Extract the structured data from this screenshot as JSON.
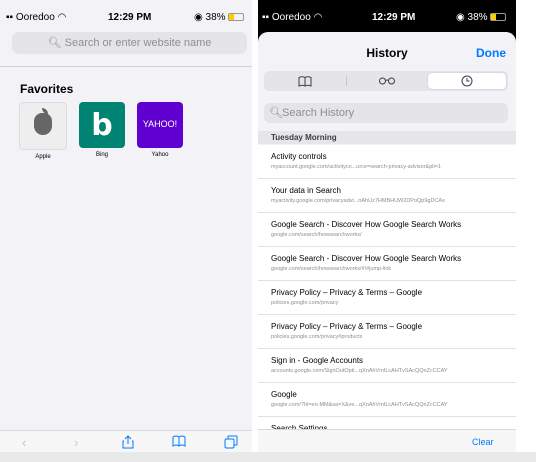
{
  "left": {
    "status": {
      "carrier": "Ooredoo",
      "time": "12:29 PM",
      "battery": "38%"
    },
    "search_placeholder": "Search or enter website name",
    "favorites_title": "Favorites",
    "favorites": [
      {
        "label": "Apple",
        "tile_color": "#eeeeee",
        "glyph": "",
        "glyph_color": "#555555"
      },
      {
        "label": "Bing",
        "tile_color": "#008373",
        "glyph": "b",
        "glyph_color": "#ffffff"
      },
      {
        "label": "Yahoo",
        "tile_color": "#6001d2",
        "glyph": "YAHOO!",
        "glyph_color": "#ffffff"
      }
    ],
    "toolbar_icons": [
      "back-icon",
      "forward-icon",
      "share-icon",
      "bookmarks-icon",
      "tabs-icon"
    ]
  },
  "right": {
    "status": {
      "carrier": "Ooredoo",
      "time": "12:29 PM",
      "battery": "38%"
    },
    "title": "History",
    "done_label": "Done",
    "segments": [
      {
        "icon": "book-icon",
        "glyph": "⎖",
        "selected": false
      },
      {
        "icon": "glasses-icon",
        "glyph": "∞",
        "selected": false
      },
      {
        "icon": "clock-icon",
        "glyph": "⏱",
        "selected": true
      }
    ],
    "search_placeholder": "Search History",
    "section_header": "Tuesday Morning",
    "items": [
      {
        "title": "Activity controls",
        "url": "myaccount.google.com/activityco...urce=search-privacy-advisor&pli=1"
      },
      {
        "title": "Your data in Search",
        "url": "myactivity.google.com/privacyadvi...nAhUz7HMBHUW2DPoQp9gDCAs"
      },
      {
        "title": "Google Search - Discover How Google Search Works",
        "url": "google.com/search/howsearchworks/"
      },
      {
        "title": "Google Search - Discover How Google Search Works",
        "url": "google.com/search/howsearchworks/#!#jump-link"
      },
      {
        "title": "Privacy Policy – Privacy & Terms – Google",
        "url": "policies.google.com/privacy"
      },
      {
        "title": "Privacy Policy – Privacy & Terms – Google",
        "url": "policies.google.com/privacy#products"
      },
      {
        "title": "Sign in - Google Accounts",
        "url": "accounts.google.com/SignOutOpti...qXnAhVmILcAHTvSAcQQnZcCCAY"
      },
      {
        "title": "Google",
        "url": "google.com/?hl=en-MM&sa=X&ve...qXnAhVmILcAHTvSAcQQnZcCCAY"
      },
      {
        "title": "Search Settings",
        "url": ""
      }
    ],
    "clear_label": "Clear"
  },
  "colors": {
    "accent": "#007aff"
  }
}
